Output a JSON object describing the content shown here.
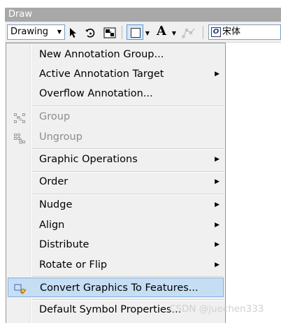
{
  "window": {
    "title": "Draw"
  },
  "toolbar": {
    "drawing_label": "Drawing",
    "text_tool": "A",
    "font_value": "宋体",
    "icons": [
      "select-elements-icon",
      "rotate-icon",
      "zoom-icon",
      "rectangle-icon",
      "text-icon",
      "edit-vertices-icon",
      "font-icon"
    ]
  },
  "menu": {
    "new_annotation_group": "New Annotation Group...",
    "active_annotation_target": "Active Annotation Target",
    "overflow_annotation": "Overflow Annotation...",
    "group": "Group",
    "ungroup": "Ungroup",
    "graphic_operations": "Graphic Operations",
    "order": "Order",
    "nudge": "Nudge",
    "align": "Align",
    "distribute": "Distribute",
    "rotate_or_flip": "Rotate or Flip",
    "convert_graphics": "Convert Graphics To Features...",
    "default_symbol": "Default Symbol Properties..."
  },
  "watermark": "CSDN @juechen333",
  "colors": {
    "highlight": "#c6def4",
    "title_bar": "#a8a8a8"
  }
}
